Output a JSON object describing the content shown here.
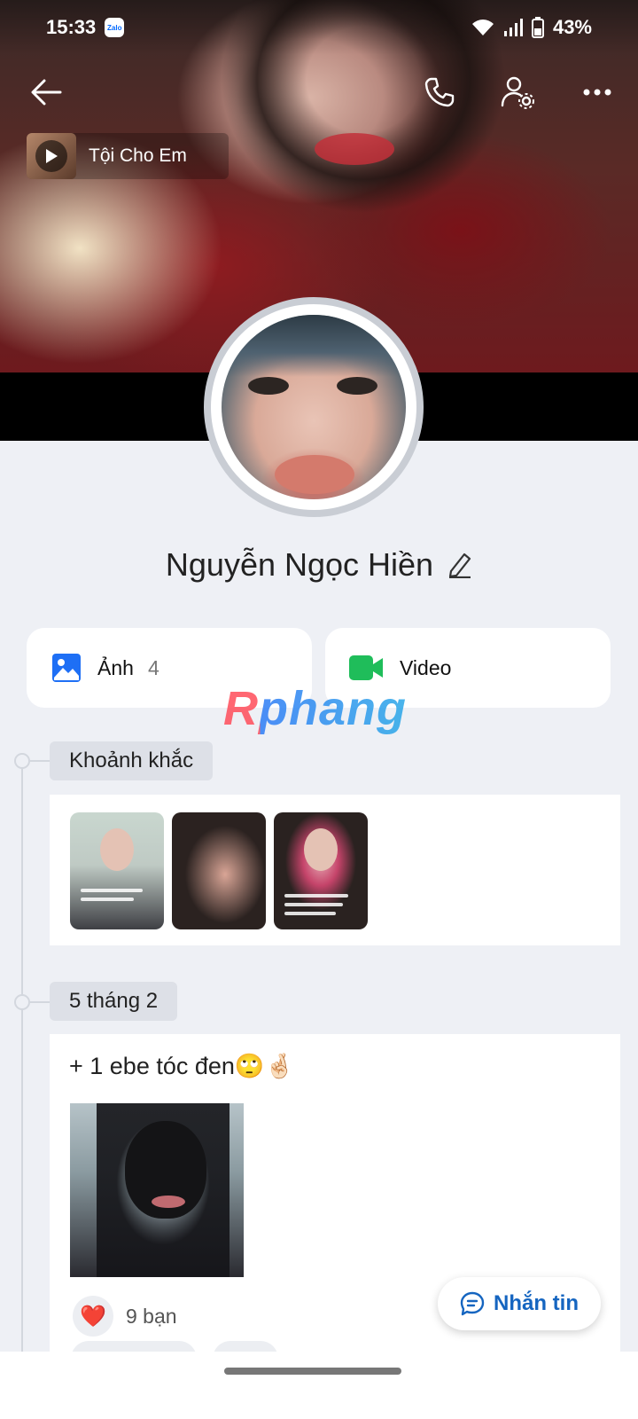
{
  "status_bar": {
    "time": "15:33",
    "notification_app": "Zalo",
    "battery": "43%"
  },
  "cover": {
    "music_title": "Tội Cho Em"
  },
  "profile": {
    "name": "Nguyễn Ngọc Hiền"
  },
  "media": {
    "photos_label": "Ảnh",
    "photos_count": "4",
    "video_label": "Video"
  },
  "watermark": "Rphang",
  "timeline": {
    "moments_label": "Khoảnh khắc",
    "date_label": "5 tháng 2"
  },
  "post": {
    "text": "+ 1  ebe tóc đen🙄🤞🏻",
    "reaction_emoji": "❤️",
    "reaction_count": "9 bạn"
  },
  "actions": {
    "message_label": "Nhắn tin"
  },
  "colors": {
    "accent_blue": "#1565c0",
    "photo_icon_blue": "#1e6ff5",
    "video_icon_green": "#1fbd5a",
    "page_bg": "#eef0f5"
  }
}
